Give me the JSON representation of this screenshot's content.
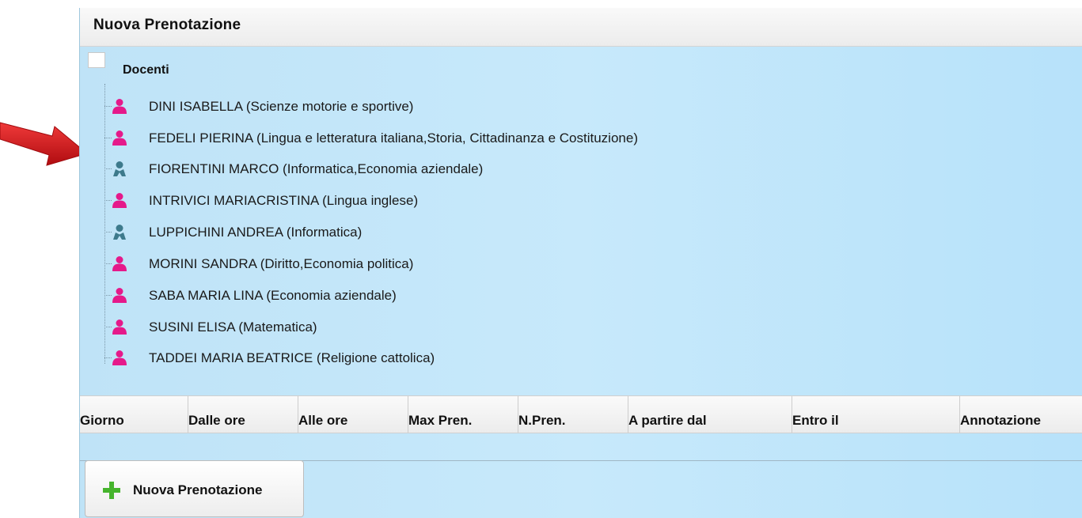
{
  "panel": {
    "title": "Nuova Prenotazione"
  },
  "tree": {
    "root_label": "Docenti",
    "items": [
      {
        "label": "DINI ISABELLA (Scienze motorie e sportive)",
        "icon": "user-female-icon"
      },
      {
        "label": "FEDELI PIERINA (Lingua e letteratura italiana,Storia, Cittadinanza e Costituzione)",
        "icon": "user-female-icon"
      },
      {
        "label": "FIORENTINI MARCO (Informatica,Economia aziendale)",
        "icon": "user-male-icon"
      },
      {
        "label": "INTRIVICI MARIACRISTINA (Lingua inglese)",
        "icon": "user-female-icon"
      },
      {
        "label": "LUPPICHINI ANDREA (Informatica)",
        "icon": "user-male-icon"
      },
      {
        "label": "MORINI SANDRA (Diritto,Economia politica)",
        "icon": "user-female-icon"
      },
      {
        "label": "SABA MARIA LINA (Economia aziendale)",
        "icon": "user-female-icon"
      },
      {
        "label": "SUSINI ELISA (Matematica)",
        "icon": "user-female-icon"
      },
      {
        "label": "TADDEI MARIA BEATRICE (Religione cattolica)",
        "icon": "user-female-icon"
      }
    ]
  },
  "table": {
    "columns": [
      "Giorno",
      "Dalle ore",
      "Alle ore",
      "Max Pren.",
      "N.Pren.",
      "A partire dal",
      "Entro il",
      "Annotazione"
    ]
  },
  "button": {
    "label": "Nuova Prenotazione",
    "icon": "plus-icon"
  },
  "colors": {
    "female_icon": "#e5198a",
    "male_icon": "#3d7a8c",
    "plus_icon": "#46b42d",
    "arrow": "#d0141a",
    "panel_bg": "#c5e8fb"
  }
}
